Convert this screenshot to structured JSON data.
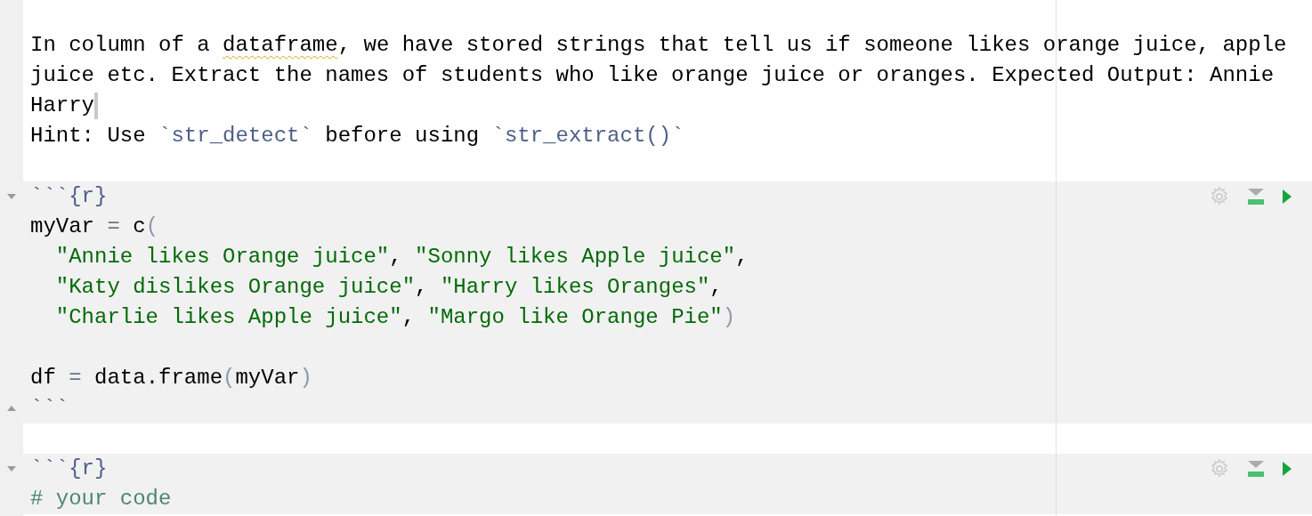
{
  "document": {
    "blocks": [
      {
        "kind": "blank"
      },
      {
        "kind": "prose",
        "lines": [
          {
            "segments": [
              {
                "text": "In column of a ",
                "kind": "plain"
              },
              {
                "text": "dataframe",
                "kind": "misspelled"
              },
              {
                "text": ", we have stored strings that tell us if someone likes orange juice, apple",
                "kind": "plain"
              }
            ],
            "cursor": false
          },
          {
            "segments": [
              {
                "text": "juice etc. Extract the names of students who like orange juice or oranges. Expected Output: Annie",
                "kind": "plain"
              }
            ],
            "cursor": false
          },
          {
            "segments": [
              {
                "text": "Harry",
                "kind": "plain"
              }
            ],
            "cursor": true
          },
          {
            "segments": [
              {
                "text": "Hint: Use ",
                "kind": "plain"
              },
              {
                "text": "`str_detect`",
                "kind": "inline_code"
              },
              {
                "text": " before using ",
                "kind": "plain"
              },
              {
                "text": "`str_extract()`",
                "kind": "inline_code"
              }
            ],
            "cursor": false
          }
        ]
      },
      {
        "kind": "blank"
      },
      {
        "kind": "chunk",
        "header": "```{r}",
        "footer": "```",
        "lines": [
          {
            "kind": "code",
            "tokens": [
              {
                "text": "myVar ",
                "kind": "plain"
              },
              {
                "text": "=",
                "kind": "operator"
              },
              {
                "text": " c",
                "kind": "plain"
              },
              {
                "text": "(",
                "kind": "paren"
              }
            ]
          },
          {
            "kind": "code",
            "tokens": [
              {
                "text": "  \"Annie likes Orange juice\"",
                "kind": "string"
              },
              {
                "text": ", ",
                "kind": "plain"
              },
              {
                "text": "\"Sonny likes Apple juice\"",
                "kind": "string"
              },
              {
                "text": ",",
                "kind": "plain"
              }
            ]
          },
          {
            "kind": "code",
            "tokens": [
              {
                "text": "  \"Katy dislikes Orange juice\"",
                "kind": "string"
              },
              {
                "text": ", ",
                "kind": "plain"
              },
              {
                "text": "\"Harry likes Oranges\"",
                "kind": "string"
              },
              {
                "text": ",",
                "kind": "plain"
              }
            ]
          },
          {
            "kind": "code",
            "tokens": [
              {
                "text": "  \"Charlie likes Apple juice\"",
                "kind": "string"
              },
              {
                "text": ", ",
                "kind": "plain"
              },
              {
                "text": "\"Margo like Orange Pie\"",
                "kind": "string"
              },
              {
                "text": ")",
                "kind": "paren"
              }
            ]
          },
          {
            "kind": "blank"
          },
          {
            "kind": "code",
            "tokens": [
              {
                "text": "df ",
                "kind": "plain"
              },
              {
                "text": "=",
                "kind": "operator"
              },
              {
                "text": " data.frame",
                "kind": "plain"
              },
              {
                "text": "(",
                "kind": "paren"
              },
              {
                "text": "myVar",
                "kind": "plain"
              },
              {
                "text": ")",
                "kind": "paren"
              }
            ]
          }
        ]
      },
      {
        "kind": "blank"
      },
      {
        "kind": "chunk",
        "header": "```{r}",
        "lines": [
          {
            "kind": "code",
            "tokens": [
              {
                "text": "# your code",
                "kind": "comment"
              }
            ]
          }
        ]
      }
    ]
  }
}
